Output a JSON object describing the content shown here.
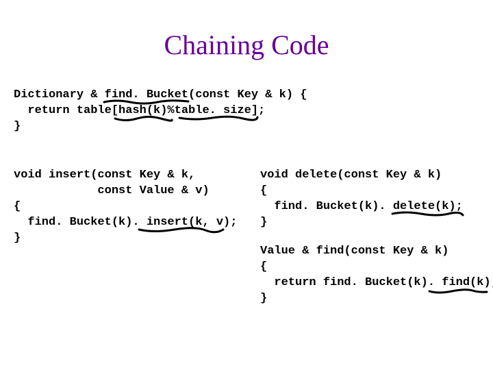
{
  "title": "Chaining Code",
  "code": {
    "findBucket": "Dictionary & find. Bucket(const Key & k) {\n  return table[hash(k)%table. size];\n}",
    "insert": "void insert(const Key & k,\n            const Value & v)\n{\n  find. Bucket(k). insert(k, v);\n}",
    "del": "void delete(const Key & k)\n{\n  find. Bucket(k). delete(k);\n}",
    "find": "Value & find(const Key & k)\n{\n  return find. Bucket(k). find(k);\n}"
  },
  "annotations": [
    {
      "name": "underline-findbucket-decl",
      "purpose": "hand underline under find.Bucket in declaration"
    },
    {
      "name": "underline-hash",
      "purpose": "hand underline under hash(k)"
    },
    {
      "name": "underline-table-size",
      "purpose": "hand underline under table.size"
    },
    {
      "name": "underline-insert-call",
      "purpose": "hand underline under insert(k,v)"
    },
    {
      "name": "underline-delete-call",
      "purpose": "hand underline under delete(k)"
    },
    {
      "name": "underline-find-call",
      "purpose": "hand underline under find(k)"
    }
  ]
}
